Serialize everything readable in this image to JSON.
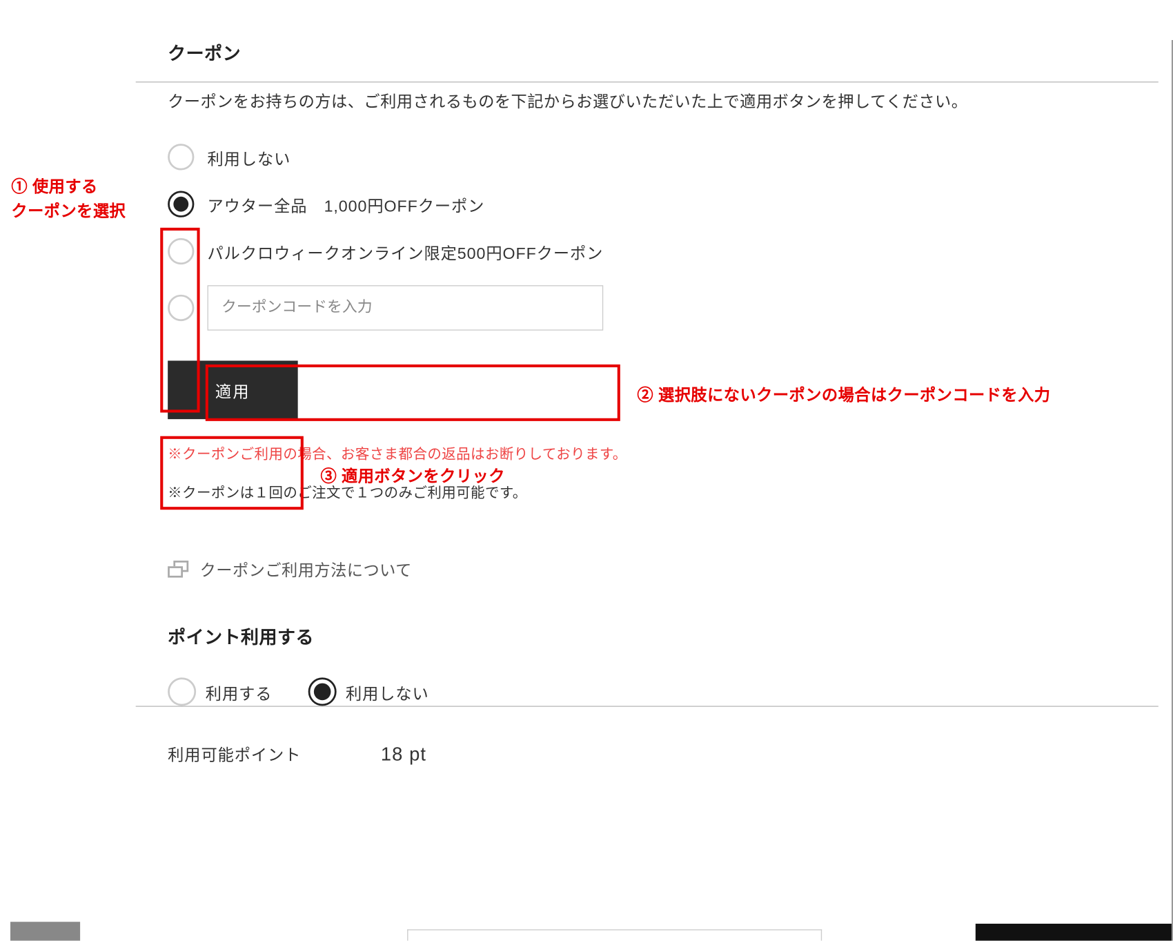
{
  "coupon": {
    "section_title": "クーポン",
    "description": "クーポンをお持ちの方は、ご利用されるものを下記からお選びいただいた上で適用ボタンを押してください。",
    "options": [
      {
        "label": "利用しない",
        "selected": false
      },
      {
        "label": "アウター全品　1,000円OFFクーポン",
        "selected": true
      },
      {
        "label": "パルクロウィークオンライン限定500円OFFクーポン",
        "selected": false
      },
      {
        "label": "",
        "selected": false
      }
    ],
    "code_placeholder": "クーポンコードを入力",
    "apply_label": "適用",
    "note_red": "※クーポンご利用の場合、お客さま都合の返品はお断りしております。",
    "note_grey": "※クーポンは１回のご注文で１つのみご利用可能です。",
    "usage_link": "クーポンご利用方法について"
  },
  "points": {
    "section_title": "ポイント利用する",
    "use_label": "利用する",
    "dont_use_label": "利用しない",
    "selected": "dont_use",
    "available_label": "利用可能ポイント",
    "available_value": "18 pt"
  },
  "annotations": {
    "a1_line1": "① 使用する",
    "a1_line2": "クーポンを選択",
    "a2": "② 選択肢にないクーポンの場合はクーポンコードを入力",
    "a3": "③ 適用ボタンをクリック"
  }
}
